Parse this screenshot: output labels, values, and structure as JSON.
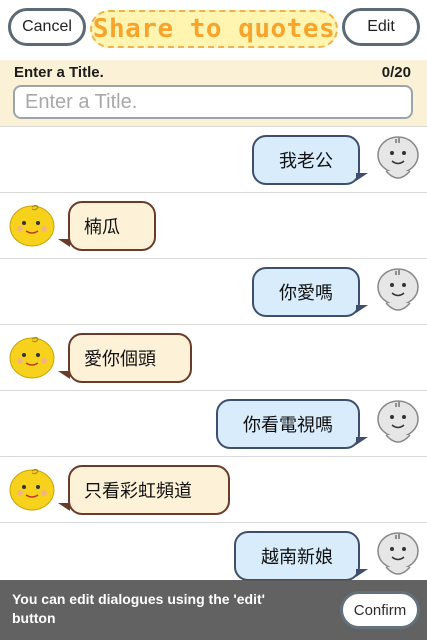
{
  "header": {
    "cancel_label": "Cancel",
    "title": "Share to quotes",
    "edit_label": "Edit"
  },
  "title_panel": {
    "label": "Enter a Title.",
    "count": "0/20",
    "placeholder": "Enter a Title."
  },
  "messages": [
    {
      "side": "right",
      "text": "我老公"
    },
    {
      "side": "left",
      "text": "楠瓜"
    },
    {
      "side": "right",
      "text": "你愛嗎"
    },
    {
      "side": "left",
      "text": "愛你個頭"
    },
    {
      "side": "right",
      "text": "你看電視嗎"
    },
    {
      "side": "left",
      "text": "只看彩虹頻道"
    },
    {
      "side": "right",
      "text": "越南新娘"
    }
  ],
  "footer": {
    "hint": "You can edit dialogues using the 'edit' button",
    "confirm_label": "Confirm"
  },
  "colors": {
    "accent_orange": "#f7a42c",
    "bubble_right_bg": "#d8ecfb",
    "bubble_left_bg": "#fdf2d8"
  }
}
